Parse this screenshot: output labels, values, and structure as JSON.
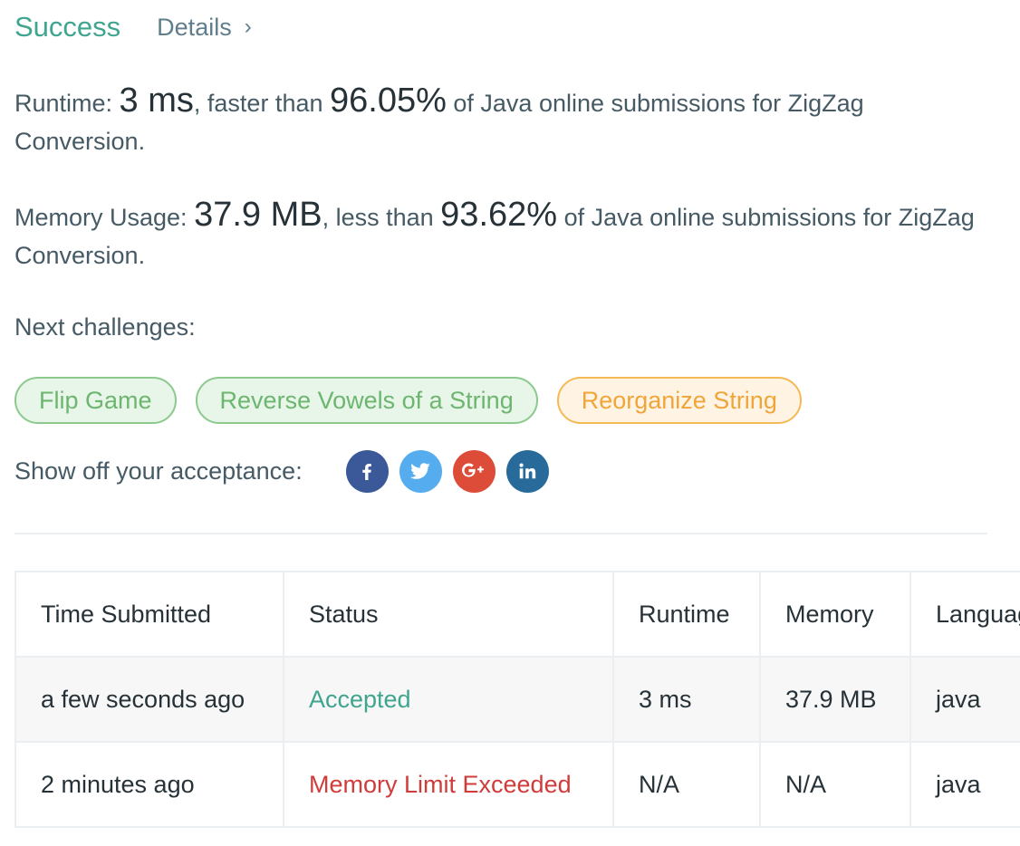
{
  "header": {
    "status_title": "Success",
    "details_label": "Details",
    "details_chevron": "›"
  },
  "runtime": {
    "label": "Runtime: ",
    "value": "3 ms",
    "compare_text": ", faster than ",
    "percent": "96.05%",
    "suffix": " of Java online submissions for ZigZag Conversion."
  },
  "memory": {
    "label": "Memory Usage: ",
    "value": "37.9 MB",
    "compare_text": ", less than ",
    "percent": "93.62%",
    "suffix": " of Java online submissions for ZigZag Conversion."
  },
  "next_challenges": {
    "label": "Next challenges:",
    "items": [
      {
        "label": "Flip Game",
        "difficulty": "easy"
      },
      {
        "label": "Reverse Vowels of a String",
        "difficulty": "easy"
      },
      {
        "label": "Reorganize String",
        "difficulty": "medium"
      }
    ]
  },
  "share": {
    "label": "Show off your acceptance:",
    "icons": [
      {
        "name": "facebook-icon",
        "color": "#3b5998"
      },
      {
        "name": "twitter-icon",
        "color": "#55acee"
      },
      {
        "name": "google-plus-icon",
        "color": "#dd4b39"
      },
      {
        "name": "linkedin-icon",
        "color": "#286a9a"
      }
    ]
  },
  "colors": {
    "success": "#3fa58f",
    "error": "#cf3c3a",
    "easy_text": "#6cb66f",
    "medium_text": "#f0a53a"
  },
  "submissions": {
    "headers": [
      "Time Submitted",
      "Status",
      "Runtime",
      "Memory",
      "Language"
    ],
    "rows": [
      {
        "time": "a few seconds ago",
        "status": "Accepted",
        "runtime": "3 ms",
        "memory": "37.9 MB",
        "language": "java"
      },
      {
        "time": "2 minutes ago",
        "status": "Memory Limit Exceeded",
        "runtime": "N/A",
        "memory": "N/A",
        "language": "java"
      }
    ]
  }
}
